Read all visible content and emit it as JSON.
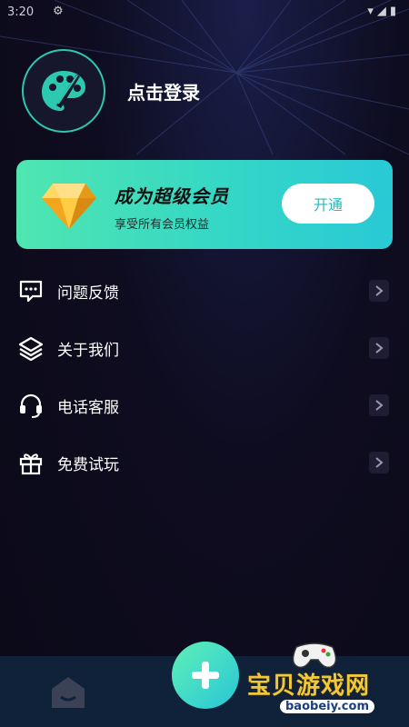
{
  "status_bar": {
    "time": "3:20"
  },
  "profile": {
    "login_text": "点击登录"
  },
  "vip_banner": {
    "title": "成为超级会员",
    "subtitle": "享受所有会员权益",
    "button_label": "开通"
  },
  "menu": {
    "items": [
      {
        "label": "问题反馈",
        "icon": "feedback-message-icon"
      },
      {
        "label": "关于我们",
        "icon": "layers-icon"
      },
      {
        "label": "电话客服",
        "icon": "headset-icon"
      },
      {
        "label": "免费试玩",
        "icon": "gift-icon"
      }
    ]
  },
  "bottom_nav": {
    "home_icon": "home-icon",
    "add_icon": "plus-icon"
  },
  "watermark": {
    "title": "宝贝游戏网",
    "url": "baobeiy.com"
  },
  "colors": {
    "accent": "#2cc8b0",
    "vip_gradient_start": "#4fe6b0",
    "vip_gradient_end": "#29c9d6",
    "background": "#0e0c1f"
  }
}
